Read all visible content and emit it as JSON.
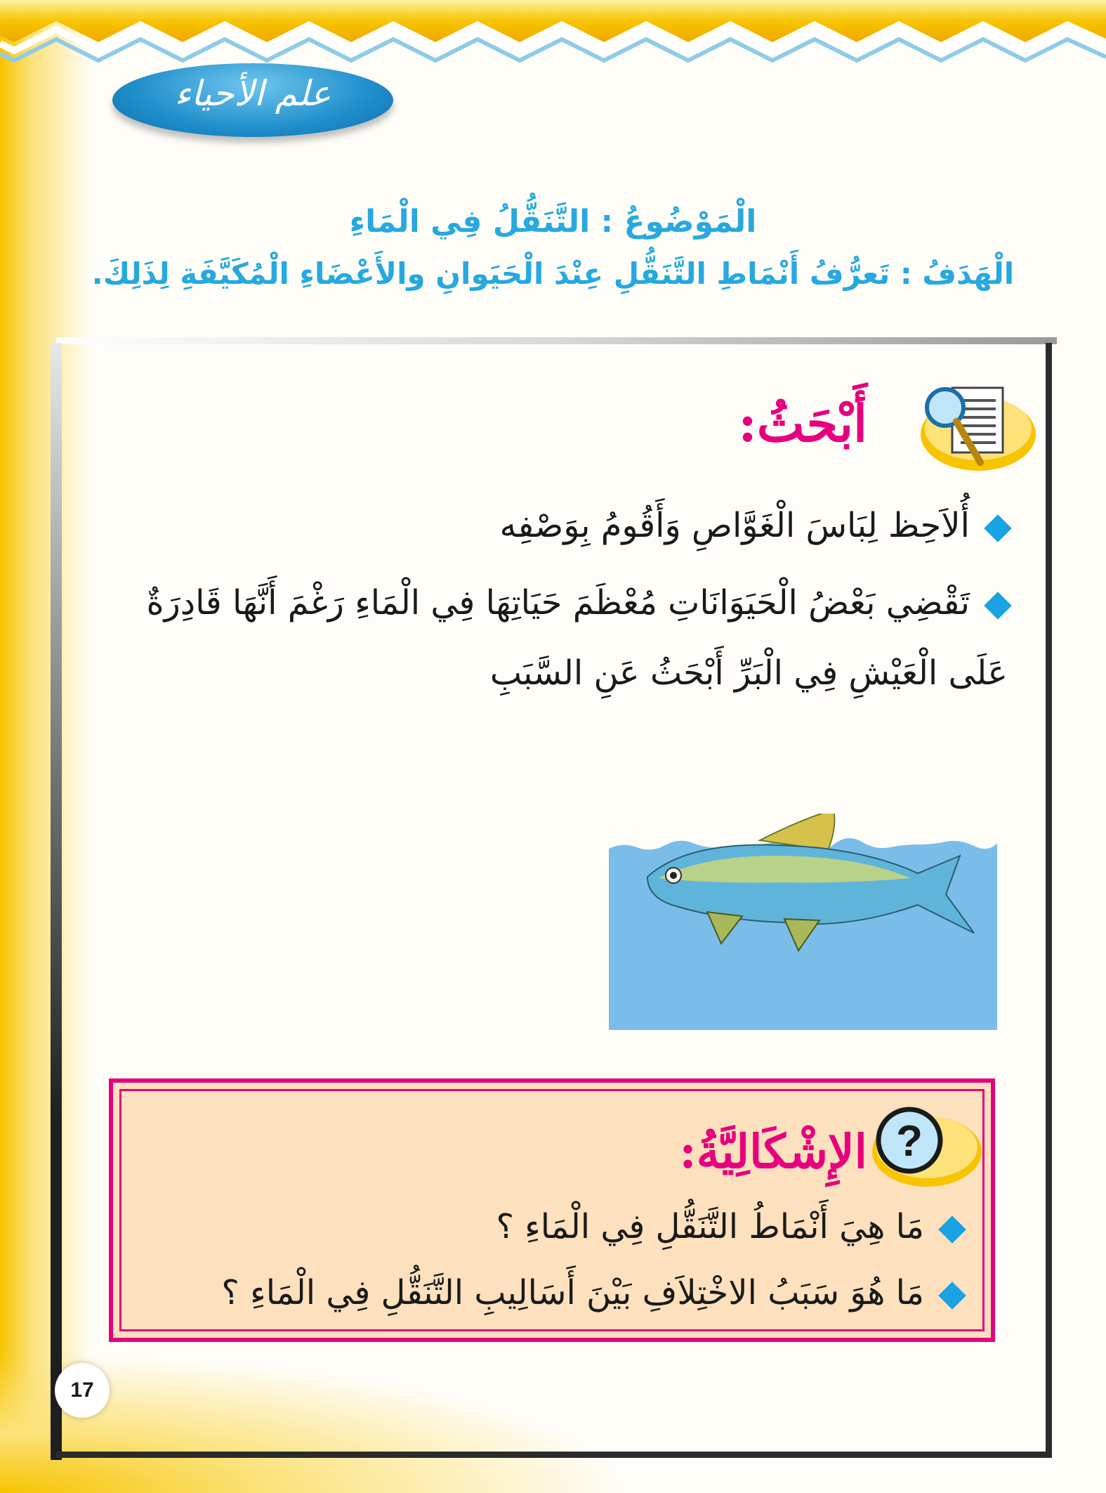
{
  "header": {
    "subject": "علم الأحياء"
  },
  "lesson": {
    "topic": "الْمَوْضُوعُ : التَّنَقُّلُ فِي الْمَاءِ",
    "goal": "الْهَدَفُ : تَعرُّفُ أَنْمَاطِ التَّنَقُّلِ عِنْدَ الْحَيَوانِ والأَعْضَاءِ الْمُكَيَّفَةِ لِذَلِكَ."
  },
  "research": {
    "title": "أَبْحَثُ:",
    "items": [
      "أُلاَحِظ لِبَاسَ الْغَوَّاصِ وَأَقُومُ بِوَصْفِه",
      "تَقْضِي بَعْضُ الْحَيَوَانَاتِ مُعْظَمَ حَيَاتِهَا فِي الْمَاءِ رَغْمَ أَنَّهَا قَادِرَةٌ",
      "عَلَى الْعَيْشِ فِي الْبَرِّ أَبْحَثُ عَنِ السَّبَبِ"
    ]
  },
  "problem": {
    "title": "الإِشْكَالِيَّةُ:",
    "items": [
      "مَا هِيَ أَنْمَاطُ التَّنَقُّلِ فِي الْمَاءِ ؟",
      "مَا هُوَ سَبَبُ الاخْتِلاَفِ بَيْنَ أَسَالِيبِ التَّنَقُّلِ فِي الْمَاءِ ؟"
    ],
    "icon_text": "?"
  },
  "page_number": "17",
  "colors": {
    "title_blue": "#27a8e0",
    "heading_pink": "#e6007e",
    "bullet_blue": "#1aa3e3",
    "problem_bg": "#fde0bd",
    "water_blue": "#7bbde9",
    "banner_yellow": "#f7c400"
  },
  "icons": {
    "research": "document-magnifier-icon",
    "problem": "question-mark-icon",
    "bullet": "diamond-bullet-icon"
  }
}
